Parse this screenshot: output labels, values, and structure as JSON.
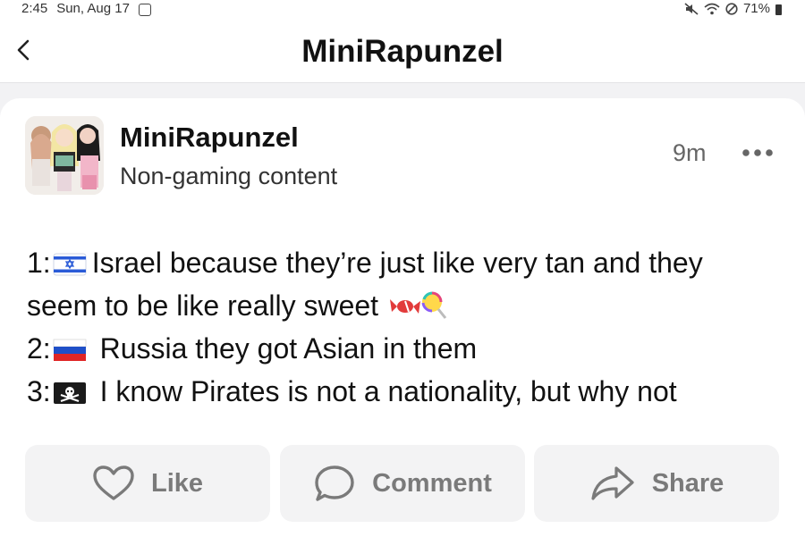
{
  "status_bar": {
    "time": "2:45",
    "date": "Sun, Aug 17",
    "battery": "71%"
  },
  "header": {
    "title": "MiniRapunzel"
  },
  "post": {
    "author": "MiniRapunzel",
    "category": "Non-gaming content",
    "time": "9m",
    "lines": [
      {
        "prefix": "1:",
        "text": "Israel because they’re just like very tan and they"
      },
      {
        "prefix": "",
        "text": "seem to be like really sweet"
      },
      {
        "prefix": "2:",
        "text": " Russia they got Asian in them"
      },
      {
        "prefix": "3:",
        "text": " I know Pirates is not a nationality, but why not"
      }
    ]
  },
  "actions": {
    "like": "Like",
    "comment": "Comment",
    "share": "Share"
  },
  "colors": {
    "background": "#f2f2f4",
    "card": "#ffffff",
    "button_bg": "#f3f3f4",
    "button_text": "#7a7a7a"
  },
  "icons": [
    "back-chevron-icon",
    "more-options-icon",
    "heart-icon",
    "comment-bubble-icon",
    "share-arrow-icon",
    "israel-flag",
    "russia-flag",
    "pirate-flag",
    "candy-emoji",
    "lollipop-emoji"
  ]
}
